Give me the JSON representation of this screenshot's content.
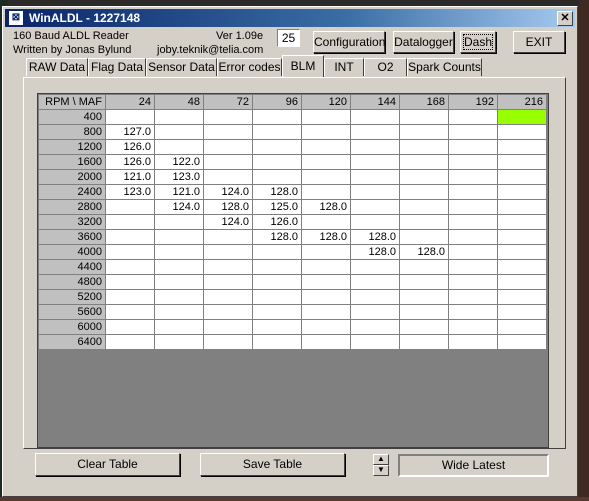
{
  "window": {
    "title": "WinALDL - 1227148",
    "icon": "app-icon",
    "close_label": "✕"
  },
  "info": {
    "line1": "160 Baud ALDL Reader",
    "line2": "Written by Jonas Bylund",
    "version": "Ver 1.09e",
    "email": "joby.teknik@telia.com",
    "counter": "25"
  },
  "toolbar": {
    "configuration": "Configuration",
    "datalogger": "Datalogger",
    "dash": "Dash",
    "exit": "EXIT"
  },
  "tabs": [
    "RAW Data",
    "Flag Data",
    "Sensor Data",
    "Error codes",
    "BLM",
    "INT",
    "O2",
    "Spark Counts"
  ],
  "active_tab": "BLM",
  "table": {
    "corner": "RPM \\ MAF",
    "columns": [
      "24",
      "48",
      "72",
      "96",
      "120",
      "144",
      "168",
      "192",
      "216"
    ],
    "rows": [
      {
        "rpm": "400",
        "cells": [
          "",
          "",
          "",
          "",
          "",
          "",
          "",
          "",
          ""
        ]
      },
      {
        "rpm": "800",
        "cells": [
          "127.0",
          "",
          "",
          "",
          "",
          "",
          "",
          "",
          ""
        ]
      },
      {
        "rpm": "1200",
        "cells": [
          "126.0",
          "",
          "",
          "",
          "",
          "",
          "",
          "",
          ""
        ]
      },
      {
        "rpm": "1600",
        "cells": [
          "126.0",
          "122.0",
          "",
          "",
          "",
          "",
          "",
          "",
          ""
        ]
      },
      {
        "rpm": "2000",
        "cells": [
          "121.0",
          "123.0",
          "",
          "",
          "",
          "",
          "",
          "",
          ""
        ]
      },
      {
        "rpm": "2400",
        "cells": [
          "123.0",
          "121.0",
          "124.0",
          "128.0",
          "",
          "",
          "",
          "",
          ""
        ]
      },
      {
        "rpm": "2800",
        "cells": [
          "",
          "124.0",
          "128.0",
          "125.0",
          "128.0",
          "",
          "",
          "",
          ""
        ]
      },
      {
        "rpm": "3200",
        "cells": [
          "",
          "",
          "124.0",
          "126.0",
          "",
          "",
          "",
          "",
          ""
        ]
      },
      {
        "rpm": "3600",
        "cells": [
          "",
          "",
          "",
          "128.0",
          "128.0",
          "128.0",
          "",
          "",
          ""
        ]
      },
      {
        "rpm": "4000",
        "cells": [
          "",
          "",
          "",
          "",
          "",
          "128.0",
          "128.0",
          "",
          ""
        ]
      },
      {
        "rpm": "4400",
        "cells": [
          "",
          "",
          "",
          "",
          "",
          "",
          "",
          "",
          ""
        ]
      },
      {
        "rpm": "4800",
        "cells": [
          "",
          "",
          "",
          "",
          "",
          "",
          "",
          "",
          ""
        ]
      },
      {
        "rpm": "5200",
        "cells": [
          "",
          "",
          "",
          "",
          "",
          "",
          "",
          "",
          ""
        ]
      },
      {
        "rpm": "5600",
        "cells": [
          "",
          "",
          "",
          "",
          "",
          "",
          "",
          "",
          ""
        ]
      },
      {
        "rpm": "6000",
        "cells": [
          "",
          "",
          "",
          "",
          "",
          "",
          "",
          "",
          ""
        ]
      },
      {
        "rpm": "6400",
        "cells": [
          "",
          "",
          "",
          "",
          "",
          "",
          "",
          "",
          ""
        ]
      }
    ],
    "highlight": {
      "row": 0,
      "col": 8,
      "color": "#99ff00"
    }
  },
  "bottom": {
    "clear": "Clear Table",
    "save": "Save Table",
    "spin_up": "▲",
    "spin_down": "▼",
    "wide": "Wide Latest"
  }
}
